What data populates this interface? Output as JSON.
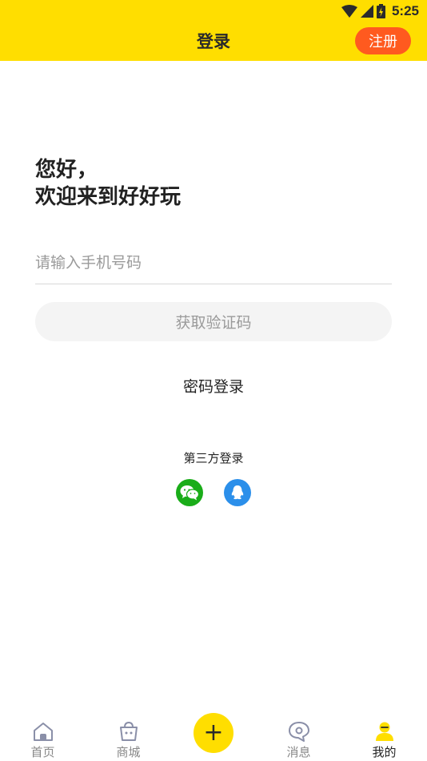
{
  "status_bar": {
    "time": "5:25"
  },
  "header": {
    "title": "登录",
    "register_label": "注册"
  },
  "greeting": {
    "line1": "您好，",
    "line2": "欢迎来到好好玩"
  },
  "phone": {
    "placeholder": "请输入手机号码",
    "value": ""
  },
  "get_code_label": "获取验证码",
  "password_login_label": "密码登录",
  "third_party": {
    "label": "第三方登录",
    "providers": [
      {
        "icon": "wechat-icon",
        "color": "#1AAD19"
      },
      {
        "icon": "qq-icon",
        "color": "#2B8FEA"
      }
    ]
  },
  "tabbar": {
    "tabs": [
      {
        "label": "首页",
        "icon": "home-icon"
      },
      {
        "label": "商城",
        "icon": "shopping-bag-icon"
      },
      {
        "label": "",
        "icon": "plus-icon",
        "glyph": "+"
      },
      {
        "label": "消息",
        "icon": "message-icon"
      },
      {
        "label": "我的",
        "icon": "profile-icon",
        "active": true
      }
    ]
  },
  "colors": {
    "brand_yellow": "#FFDE00",
    "register_orange": "#FF5A1F"
  }
}
